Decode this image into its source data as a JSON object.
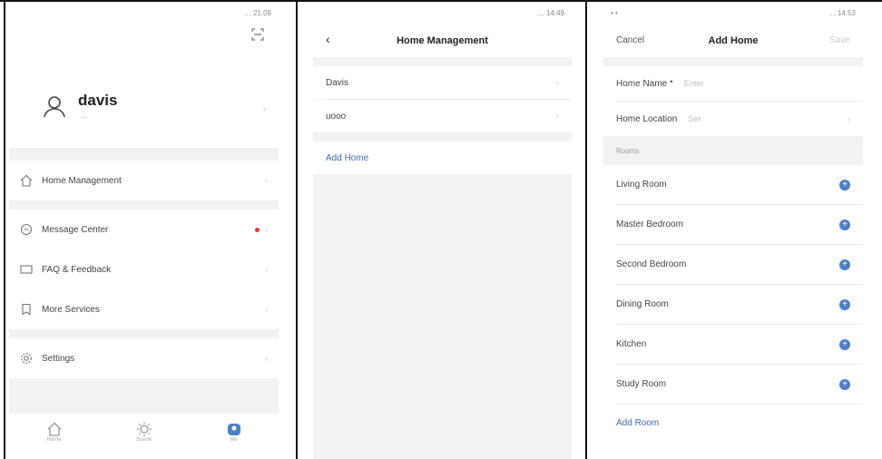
{
  "left_panel": {
    "status": "… 21:09",
    "user": {
      "name": "davis",
      "subtitle": "…"
    },
    "menu": {
      "home_management": "Home Management",
      "message_center": "Message Center",
      "faq_feedback": "FAQ & Feedback",
      "more_services": "More Services",
      "settings": "Settings"
    },
    "tabs": [
      "Home",
      "Scene",
      "Me"
    ]
  },
  "middle_panel": {
    "status": "… 14:49",
    "title": "Home Management",
    "homes": [
      "Davis",
      "uooo"
    ],
    "add_home": "Add Home"
  },
  "right_panel": {
    "status_left": "• •",
    "status": "… 14:53",
    "cancel": "Cancel",
    "title": "Add Home",
    "save": "Save",
    "home_name_label": "Home Name *",
    "home_name_placeholder": "Enter",
    "home_location_label": "Home Location",
    "home_location_value": "Set",
    "rooms_header": "Rooms",
    "rooms": [
      "Living Room",
      "Master Bedroom",
      "Second Bedroom",
      "Dining Room",
      "Kitchen",
      "Study Room"
    ],
    "add_room": "Add Room"
  },
  "colors": {
    "accent": "#3d6fb8",
    "badge": "#e53935",
    "background": "#f2f2f2"
  }
}
